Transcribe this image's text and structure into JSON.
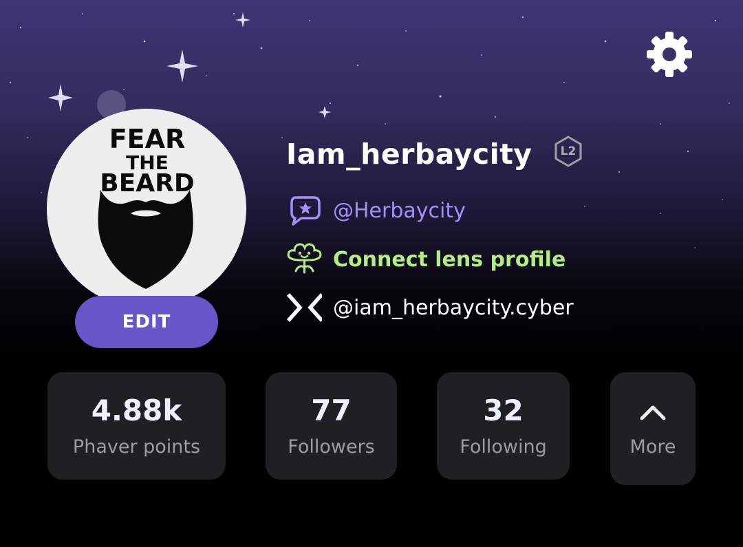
{
  "profile": {
    "username": "Iam_herbaycity",
    "level": "L2",
    "edit_label": "EDIT",
    "avatar_text": [
      "FEAR",
      "THE",
      "BEARD"
    ],
    "links": {
      "phaver_handle": "@Herbaycity",
      "lens_label": "Connect lens profile",
      "cyber_handle": "@iam_herbaycity.cyber"
    }
  },
  "stats": [
    {
      "value": "4.88k",
      "label": "Phaver points"
    },
    {
      "value": "77",
      "label": "Followers"
    },
    {
      "value": "32",
      "label": "Following"
    }
  ],
  "more_label": "More",
  "icons": {
    "settings": "gear-icon",
    "phaver": "chat-star-icon",
    "lens": "lens-plant-icon",
    "cyberconnect": "cyberconnect-x-icon",
    "more": "chevron-up-icon"
  },
  "colors": {
    "accent": "#6656c7",
    "phaver_text": "#a48ff6",
    "lens_text": "#b5ed85",
    "card_bg": "#202022"
  }
}
